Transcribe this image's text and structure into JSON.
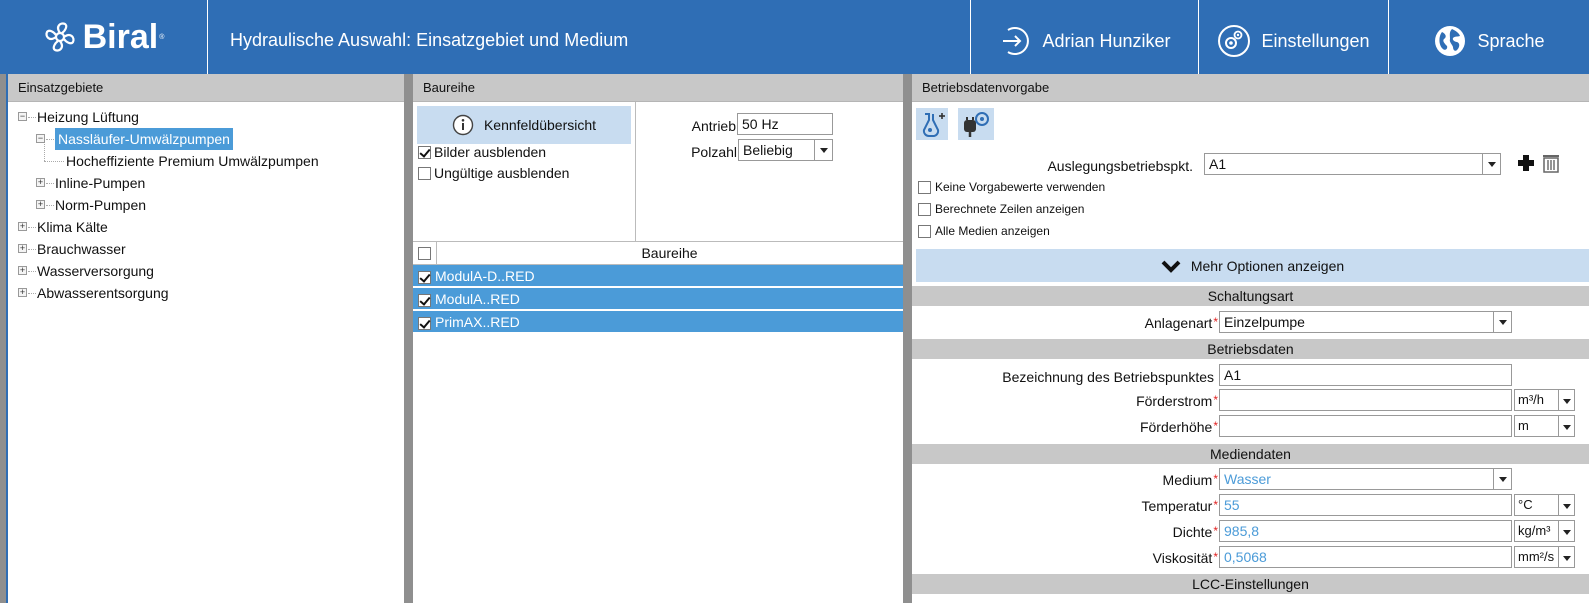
{
  "header": {
    "logo_text": "Biral",
    "logo_reg": "®",
    "title": "Hydraulische Auswahl: Einsatzgebiet und Medium",
    "user_label": "Adrian Hunziker",
    "settings_label": "Einstellungen",
    "language_label": "Sprache"
  },
  "left": {
    "header": "Einsatzgebiete",
    "tree": [
      {
        "label": "Heizung Lüftung",
        "level": 0,
        "expanded": true
      },
      {
        "label": "Nassläufer-Umwälzpumpen",
        "level": 1,
        "expanded": true,
        "selected": true
      },
      {
        "label": "Hocheffiziente Premium Umwälzpumpen",
        "level": 2
      },
      {
        "label": "Inline-Pumpen",
        "level": 1,
        "expanded": false
      },
      {
        "label": "Norm-Pumpen",
        "level": 1,
        "expanded": false
      },
      {
        "label": "Klima Kälte",
        "level": 0,
        "expanded": false
      },
      {
        "label": "Brauchwasser",
        "level": 0,
        "expanded": false
      },
      {
        "label": "Wasserversorgung",
        "level": 0,
        "expanded": false
      },
      {
        "label": "Abwasserentsorgung",
        "level": 0,
        "expanded": false
      }
    ]
  },
  "mid": {
    "header": "Baureihe",
    "kennfeld_label": "Kennfeldübersicht",
    "hide_images_label": "Bilder ausblenden",
    "hide_invalid_label": "Ungültige ausblenden",
    "antrieb_label": "Antrieb",
    "antrieb_value": "50 Hz",
    "polzahl_label": "Polzahl",
    "polzahl_value": "Beliebig",
    "grid_header": "Baureihe",
    "rows": [
      "ModulA-D..RED",
      "ModulA..RED",
      "PrimAX..RED"
    ]
  },
  "right": {
    "header": "Betriebsdatenvorgabe",
    "ausl_label": "Auslegungsbetriebspkt.",
    "ausl_value": "A1",
    "opt1": "Keine Vorgabewerte verwenden",
    "opt2": "Berechnete Zeilen anzeigen",
    "opt3": "Alle Medien anzeigen",
    "more_options": "Mehr Optionen anzeigen",
    "sec_schaltung": "Schaltungsart",
    "anlagenart_label": "Anlagenart",
    "anlagenart_value": "Einzelpumpe",
    "sec_betrieb": "Betriebsdaten",
    "bez_label": "Bezeichnung des Betriebspunktes",
    "bez_value": "A1",
    "foerderstrom_label": "Förderstrom",
    "foerderstrom_unit": "m³/h",
    "foerderhoehe_label": "Förderhöhe",
    "foerderhoehe_unit": "m",
    "sec_medien": "Mediendaten",
    "medium_label": "Medium",
    "medium_value": "Wasser",
    "temp_label": "Temperatur",
    "temp_value": "55",
    "temp_unit": "°C",
    "dichte_label": "Dichte",
    "dichte_value": "985,8",
    "dichte_unit": "kg/m³",
    "visk_label": "Viskosität",
    "visk_value": "0,5068",
    "visk_unit": "mm²/s",
    "sec_lcc": "LCC-Einstellungen",
    "required_mark": "*"
  },
  "colors": {
    "brand_blue": "#2f6eb5",
    "selection_blue": "#4b9bd8",
    "panel_header": "#c8c8c8",
    "required_red": "#e02020"
  }
}
